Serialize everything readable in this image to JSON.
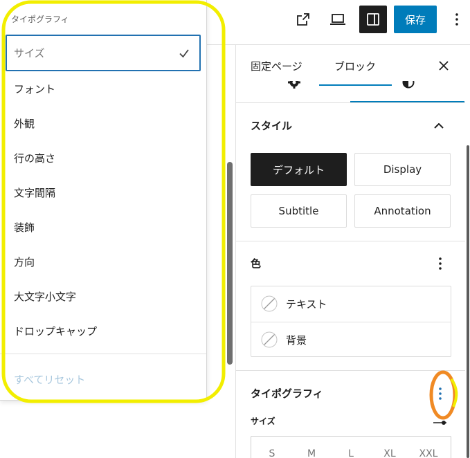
{
  "header": {
    "icons": {
      "view": "external-link-icon",
      "preview": "laptop-icon",
      "settings": "sidebar-toggle-icon",
      "options": "more-vertical-icon"
    },
    "save_label": "保存"
  },
  "typography_menu": {
    "heading": "タイポグラフィ",
    "items": [
      {
        "label": "サイズ",
        "checked": true
      },
      {
        "label": "フォント",
        "checked": false
      },
      {
        "label": "外観",
        "checked": false
      },
      {
        "label": "行の高さ",
        "checked": false
      },
      {
        "label": "文字間隔",
        "checked": false
      },
      {
        "label": "装飾",
        "checked": false
      },
      {
        "label": "方向",
        "checked": false
      },
      {
        "label": "大文字小文字",
        "checked": false
      },
      {
        "label": "ドロップキャップ",
        "checked": false
      }
    ],
    "reset_label": "すべてリセット"
  },
  "sidebar": {
    "tabs": [
      {
        "label": "固定ページ",
        "active": false
      },
      {
        "label": "ブロック",
        "active": true
      }
    ],
    "close_icon": "close-icon",
    "inspector_tabs": [
      {
        "icon": "settings-gear-icon",
        "active": false
      },
      {
        "icon": "styles-icon",
        "active": true
      }
    ],
    "styles": {
      "heading": "スタイル",
      "options": [
        {
          "label": "デフォルト",
          "selected": true
        },
        {
          "label": "Display",
          "selected": false
        },
        {
          "label": "Subtitle",
          "selected": false
        },
        {
          "label": "Annotation",
          "selected": false
        }
      ]
    },
    "color": {
      "heading": "色",
      "items": [
        {
          "label": "テキスト",
          "icon": "no-color-swatch-icon"
        },
        {
          "label": "背景",
          "icon": "no-color-swatch-icon"
        }
      ]
    },
    "typography": {
      "heading": "タイポグラフィ",
      "size_label": "サイズ",
      "size_options": [
        "S",
        "M",
        "L",
        "XL",
        "XXL"
      ],
      "custom_size_icon": "custom-size-slider-icon"
    }
  },
  "colors": {
    "accent": "#007cba",
    "focus_border": "#2271b1",
    "selected_style_bg": "#1e1e1e",
    "reset_disabled": "#a9c8de",
    "annotation_yellow": "#f2ee00",
    "annotation_orange": "#f08a24"
  }
}
